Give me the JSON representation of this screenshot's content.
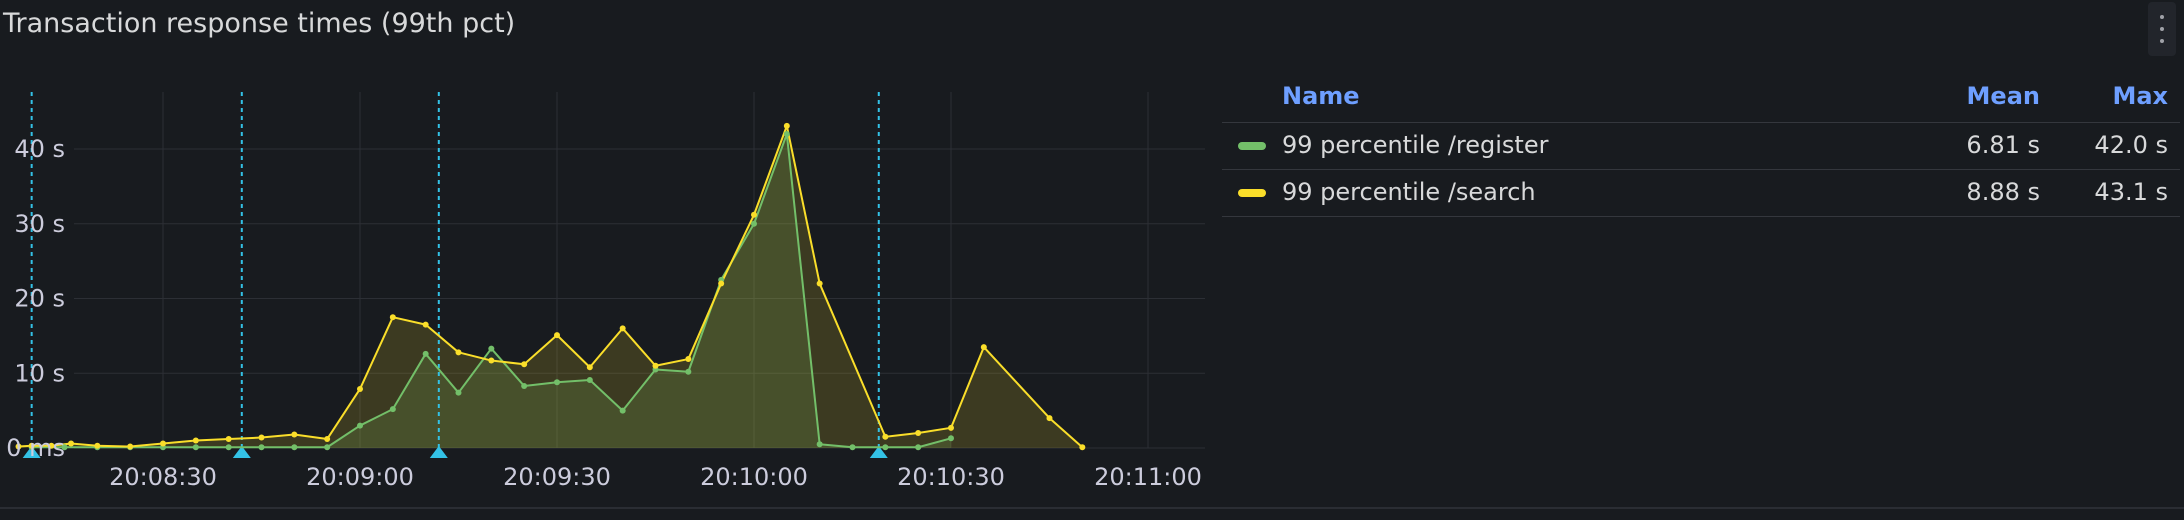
{
  "panel": {
    "title": "Transaction response times (99th pct)"
  },
  "legend": {
    "headers": {
      "name": "Name",
      "mean": "Mean",
      "max": "Max"
    },
    "rows": [
      {
        "name": "99 percentile /register",
        "mean": "6.81 s",
        "max": "42.0 s",
        "color": "#73bf69"
      },
      {
        "name": "99 percentile /search",
        "mean": "8.88 s",
        "max": "43.1 s",
        "color": "#fade2a"
      }
    ]
  },
  "chart_data": {
    "type": "area",
    "title": "Transaction response times (99th pct)",
    "xlabel": "",
    "ylabel": "",
    "x_ticks": [
      "20:08:30",
      "20:09:00",
      "20:09:30",
      "20:10:00",
      "20:10:30",
      "20:11:00"
    ],
    "y_ticks": [
      "0 ms",
      "10 s",
      "20 s",
      "30 s",
      "40 s"
    ],
    "ylim": [
      0,
      48
    ],
    "grid": true,
    "legend_position": "right",
    "annotation_times": [
      "20:08:10",
      "20:08:42",
      "20:09:12",
      "20:10:19"
    ],
    "annotation_color": "#33c2e6",
    "series": [
      {
        "name": "99 percentile /register",
        "color": "#73bf69",
        "x": [
          "20:08:10",
          "20:08:15",
          "20:08:20",
          "20:08:25",
          "20:08:30",
          "20:08:35",
          "20:08:40",
          "20:08:45",
          "20:08:50",
          "20:08:55",
          "20:09:00",
          "20:09:05",
          "20:09:10",
          "20:09:15",
          "20:09:20",
          "20:09:25",
          "20:09:30",
          "20:09:35",
          "20:09:40",
          "20:09:45",
          "20:09:50",
          "20:09:55",
          "20:10:00",
          "20:10:05",
          "20:10:10",
          "20:10:15",
          "20:10:20",
          "20:10:25",
          "20:10:30"
        ],
        "values": [
          0.1,
          0.1,
          0.1,
          0.1,
          0.1,
          0.1,
          0.1,
          0.1,
          0.1,
          0.1,
          3.0,
          5.2,
          12.6,
          7.4,
          13.3,
          8.3,
          8.8,
          9.1,
          5.0,
          10.5,
          10.2,
          22.5,
          30.0,
          42.0,
          0.5,
          0.1,
          0.1,
          0.1,
          1.3
        ]
      },
      {
        "name": "99 percentile /search",
        "color": "#fade2a",
        "x": [
          "20:08:08",
          "20:08:10",
          "20:08:13",
          "20:08:16",
          "20:08:20",
          "20:08:25",
          "20:08:30",
          "20:08:35",
          "20:08:40",
          "20:08:45",
          "20:08:50",
          "20:08:55",
          "20:09:00",
          "20:09:05",
          "20:09:10",
          "20:09:15",
          "20:09:20",
          "20:09:25",
          "20:09:30",
          "20:09:35",
          "20:09:40",
          "20:09:45",
          "20:09:50",
          "20:09:55",
          "20:10:00",
          "20:10:05",
          "20:10:10",
          "20:10:20",
          "20:10:25",
          "20:10:30",
          "20:10:35",
          "20:10:45",
          "20:10:50"
        ],
        "values": [
          0.2,
          0.3,
          0.3,
          0.6,
          0.3,
          0.2,
          0.6,
          1.0,
          1.2,
          1.4,
          1.8,
          1.2,
          7.9,
          17.5,
          16.5,
          12.8,
          11.7,
          11.2,
          15.1,
          10.8,
          16.0,
          11.0,
          11.9,
          22.0,
          31.2,
          43.1,
          22.0,
          1.5,
          2.0,
          2.7,
          13.5,
          4.0,
          0.1
        ]
      }
    ]
  }
}
